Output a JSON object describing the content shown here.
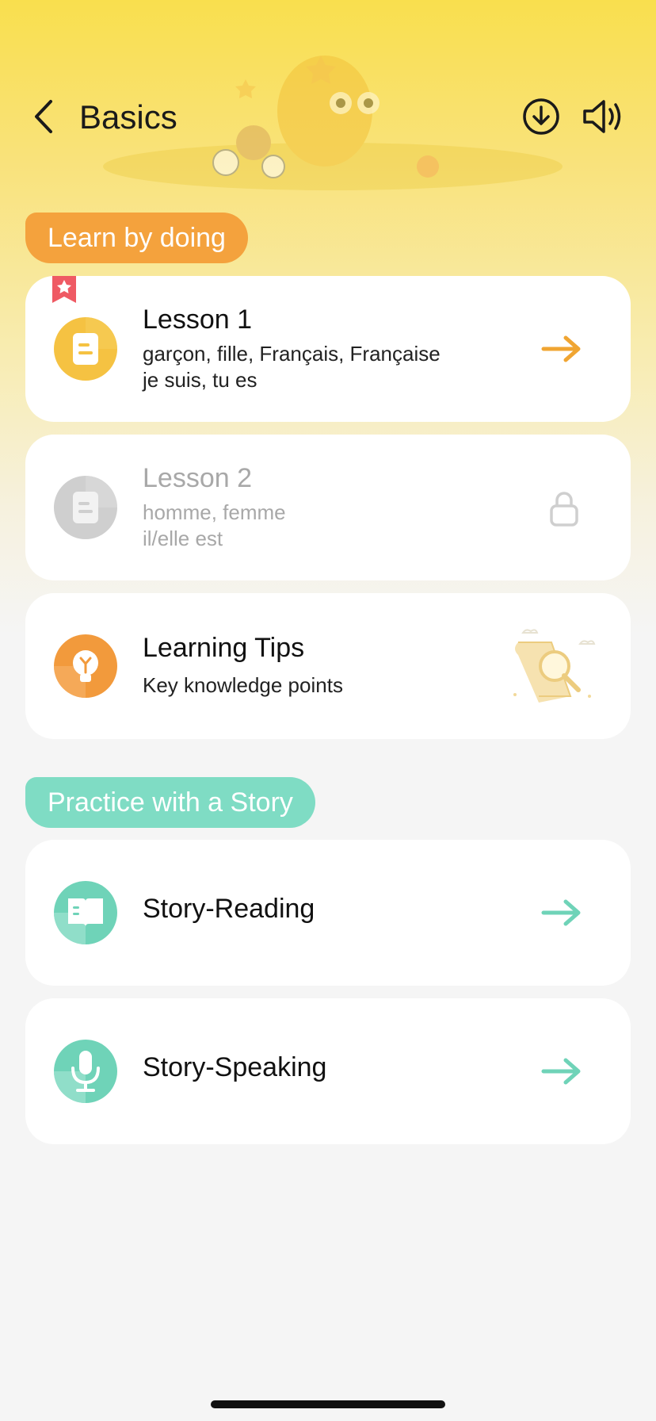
{
  "header": {
    "title": "Basics"
  },
  "sections": {
    "learn": {
      "label": "Learn by doing"
    },
    "practice": {
      "label": "Practice with a Story"
    }
  },
  "lessons": [
    {
      "title": "Lesson 1",
      "line1": "garçon, fille, Français, Française",
      "line2": "je suis, tu es",
      "state": "unlocked",
      "icon": "document-icon",
      "action_icon": "arrow-right-icon"
    },
    {
      "title": "Lesson 2",
      "line1": "homme, femme",
      "line2": "il/elle est",
      "state": "locked",
      "icon": "document-icon",
      "action_icon": "lock-icon"
    }
  ],
  "tips": {
    "title": "Learning Tips",
    "subtitle": "Key knowledge points",
    "icon": "lightbulb-icon"
  },
  "stories": [
    {
      "title": "Story-Reading",
      "icon": "book-icon",
      "action_icon": "arrow-right-icon"
    },
    {
      "title": "Story-Speaking",
      "icon": "microphone-icon",
      "action_icon": "arrow-right-icon"
    }
  ],
  "colors": {
    "accent_orange": "#f4a23d",
    "accent_yellow": "#f5c242",
    "accent_teal": "#7fdcc4",
    "locked_gray": "#a8a8a8",
    "bookmark_red": "#ef5a64"
  }
}
